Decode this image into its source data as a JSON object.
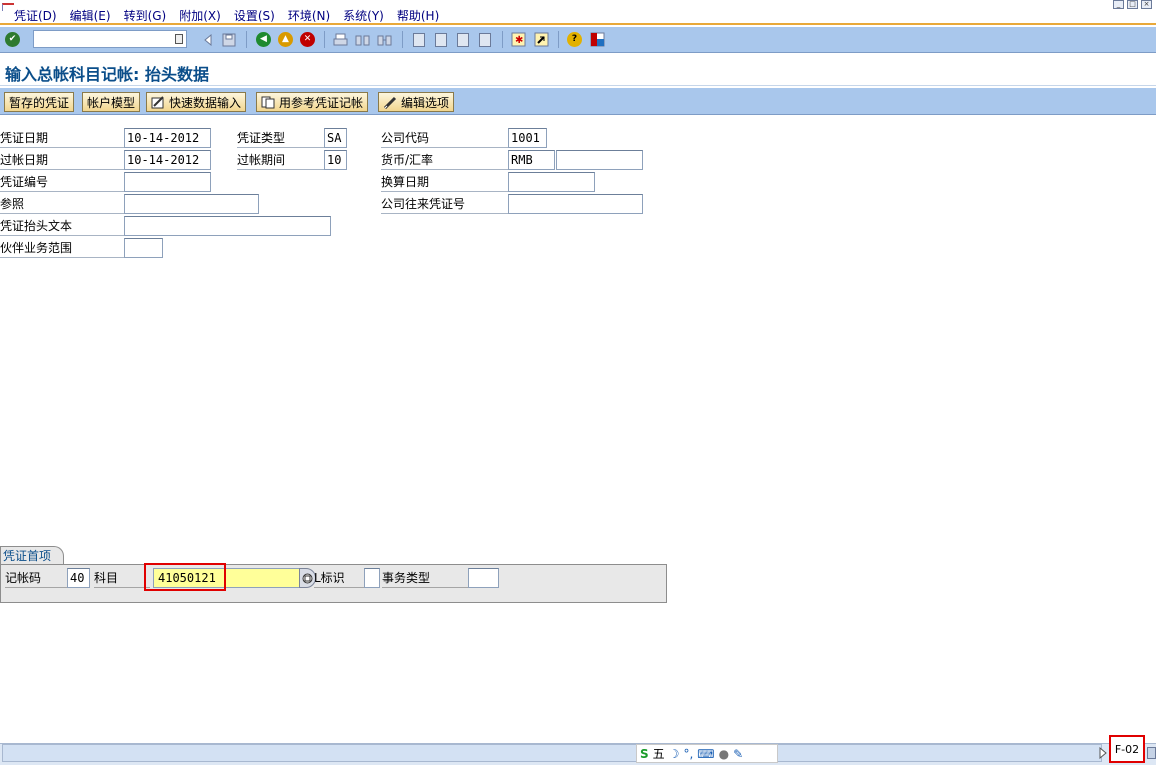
{
  "menu": {
    "items": [
      "凭证(D)",
      "编辑(E)",
      "转到(G)",
      "附加(X)",
      "设置(S)",
      "环境(N)",
      "系统(Y)",
      "帮助(H)"
    ]
  },
  "toolbar": {
    "command_value": "",
    "icons": [
      "enter-check-icon",
      "command-dropdown-icon",
      "back-arrow-icon",
      "save-icon",
      "back-icon",
      "exit-icon",
      "cancel-icon",
      "print-icon",
      "find-icon",
      "find-next-icon",
      "first-page-icon",
      "previous-page-icon",
      "next-page-icon",
      "last-page-icon",
      "new-session-icon",
      "shortcut-icon",
      "help-icon",
      "layout-menu-icon"
    ]
  },
  "page": {
    "title": "输入总帐科目记帐: 抬头数据"
  },
  "app_toolbar": {
    "buttons": [
      "暂存的凭证",
      "帐户模型",
      "快速数据输入",
      "用参考凭证记帐",
      "编辑选项"
    ]
  },
  "header": {
    "doc_date_label": "凭证日期",
    "doc_date": "10-14-2012",
    "posting_date_label": "过帐日期",
    "posting_date": "10-14-2012",
    "doc_number_label": "凭证编号",
    "doc_number": "",
    "reference_label": "参照",
    "reference": "",
    "header_text_label": "凭证抬头文本",
    "header_text": "",
    "trading_partner_label": "伙伴业务范围",
    "trading_partner": "",
    "doc_type_label": "凭证类型",
    "doc_type": "SA",
    "period_label": "过帐期间",
    "period": "10",
    "company_code_label": "公司代码",
    "company_code": "1001",
    "currency_label": "货币/汇率",
    "currency": "RMB",
    "exchange_rate": "",
    "translation_date_label": "换算日期",
    "translation_date": "",
    "intercompany_label": "公司往来凭证号",
    "intercompany": ""
  },
  "first_line_item": {
    "tab_label": "凭证首项",
    "posting_key_label": "记帐码",
    "posting_key": "40",
    "account_label": "科目",
    "account": "41050121",
    "sp_gl_label": "L标识",
    "sp_gl": "",
    "transaction_type_label": "事务类型",
    "transaction_type": ""
  },
  "status_bar": {
    "message": "",
    "ime_text": "五",
    "transaction_code": "F-02"
  },
  "colors": {
    "toolbar_bg": "#a9c7ec",
    "title_color": "#0b4e8a",
    "highlight_red": "#e00000",
    "required_field": "#ffff99",
    "button_bg": "#f2d68f"
  }
}
